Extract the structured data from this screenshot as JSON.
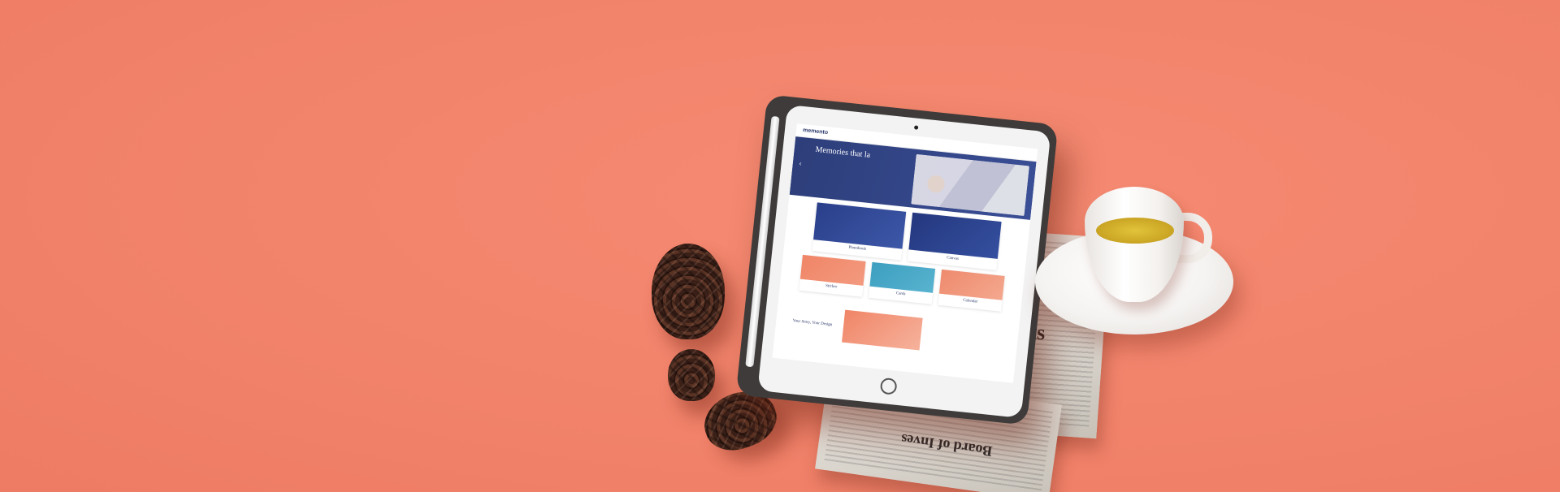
{
  "scene": {
    "background_color": "#f2836b",
    "objects": [
      "pine-cones",
      "tablet",
      "apple-pencil",
      "newspaper",
      "tea-cup",
      "saucer"
    ]
  },
  "newspaper": {
    "headline_right": "ghts",
    "headline_bottom": "Board of Inves"
  },
  "site": {
    "logo": "memento",
    "nav_links": [
      "",
      "",
      "",
      "",
      ""
    ],
    "hero": {
      "title": "Memories that la",
      "subtitle": "",
      "button": "",
      "prev_arrow": "‹"
    },
    "products": [
      {
        "name": "Photobook",
        "desc": ""
      },
      {
        "name": "Canvas",
        "desc": ""
      },
      {
        "name": "Sticker",
        "desc": ""
      },
      {
        "name": "Cards",
        "desc": ""
      },
      {
        "name": "Calendar",
        "desc": ""
      }
    ],
    "story_title": "Your Story, Your Design"
  }
}
